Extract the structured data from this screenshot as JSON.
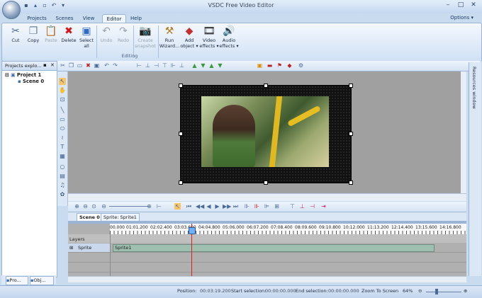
{
  "window": {
    "title": "VSDC Free Video Editor"
  },
  "ribbon_tabs": [
    "Projects",
    "Scenes",
    "View",
    "Editor",
    "Help"
  ],
  "options_label": "Options ▾",
  "ribbon": {
    "buttons": [
      {
        "label": "Cut",
        "icon": "scissors-icon",
        "glyph": "✂"
      },
      {
        "label": "Copy",
        "icon": "copy-icon",
        "glyph": "❐"
      },
      {
        "label": "Paste",
        "icon": "paste-icon",
        "glyph": "📋"
      },
      {
        "label": "Delete",
        "icon": "delete-icon",
        "glyph": "✖"
      },
      {
        "label": "Select",
        "label2": "all",
        "icon": "select-all-icon",
        "glyph": "▣"
      },
      {
        "label": "Undo",
        "icon": "undo-icon",
        "glyph": "↶"
      },
      {
        "label": "Redo",
        "icon": "redo-icon",
        "glyph": "↷"
      },
      {
        "label": "Create",
        "label2": "snapshot",
        "icon": "snapshot-icon",
        "glyph": "📷"
      },
      {
        "label": "Run",
        "label2": "Wizard...",
        "icon": "wizard-icon",
        "glyph": "⚒"
      },
      {
        "label": "Add",
        "label2": "object ▾",
        "icon": "add-object-icon",
        "glyph": "◆"
      },
      {
        "label": "Video",
        "label2": "effects ▾",
        "icon": "video-effects-icon",
        "glyph": "🎞"
      },
      {
        "label": "Audio",
        "label2": "effects ▾",
        "icon": "audio-effects-icon",
        "glyph": "🔊"
      }
    ],
    "group_label": "Editing"
  },
  "explorer": {
    "title": "Projects explo...",
    "project": "Project 1",
    "scene": "Scene 0",
    "tabs": [
      "Pro...",
      "Obj..."
    ]
  },
  "resources_label": "Resources window",
  "timeline": {
    "tabs": [
      "Scene 0",
      "Sprite: Sprite1"
    ],
    "ruler": [
      "00.000",
      "01:01.200",
      "02:02.400",
      "03:03.600",
      "04:04.800",
      "05:06.000",
      "06:07.200",
      "07:08.400",
      "08:09.600",
      "09:10.800",
      "10:12.000",
      "11:13.200",
      "12:14.400",
      "13:15.600",
      "14:16.800"
    ],
    "layers_label": "Layers",
    "track": "Sprite",
    "clip": "Sprite1"
  },
  "status": {
    "position_label": "Position:",
    "position": "00:03:19.200",
    "start_label": "Start selection:",
    "start": "00:00:00.000",
    "end_label": "End selection:",
    "end": "00:00:00.000",
    "zoom_label": "Zoom To Screen",
    "zoom": "64%"
  }
}
